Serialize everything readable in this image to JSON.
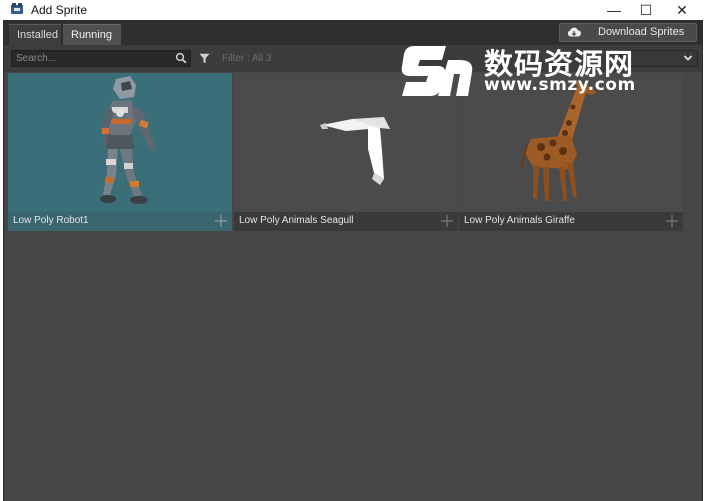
{
  "window": {
    "title": "Add Sprite",
    "controls": {
      "minimize": "—",
      "maximize": "☐",
      "close": "✕"
    }
  },
  "tabs": [
    {
      "label": "Installed",
      "active": false
    },
    {
      "label": "Running",
      "active": true
    }
  ],
  "toolbar": {
    "download_label": "Download Sprites",
    "download_icon": "cloud-download-icon"
  },
  "filterbar": {
    "search_placeholder": "Search...",
    "search_icon": "search-icon",
    "filter_icon": "filter-icon",
    "filter_text": "Filter : All 3",
    "dropdown_icon": "chevron-down-icon"
  },
  "sprites": [
    {
      "name": "Low Poly Robot1",
      "selected": true
    },
    {
      "name": "Low Poly Animals Seagull",
      "selected": false
    },
    {
      "name": "Low Poly Animals Giraffe",
      "selected": false
    }
  ],
  "watermark": {
    "title": "数码资源网",
    "url": "www.smzy.com"
  },
  "colors": {
    "panel": "#464646",
    "tabstrip": "#2f2f2f",
    "selected_card": "#3a6e78",
    "caption": "#3a3a3a"
  }
}
